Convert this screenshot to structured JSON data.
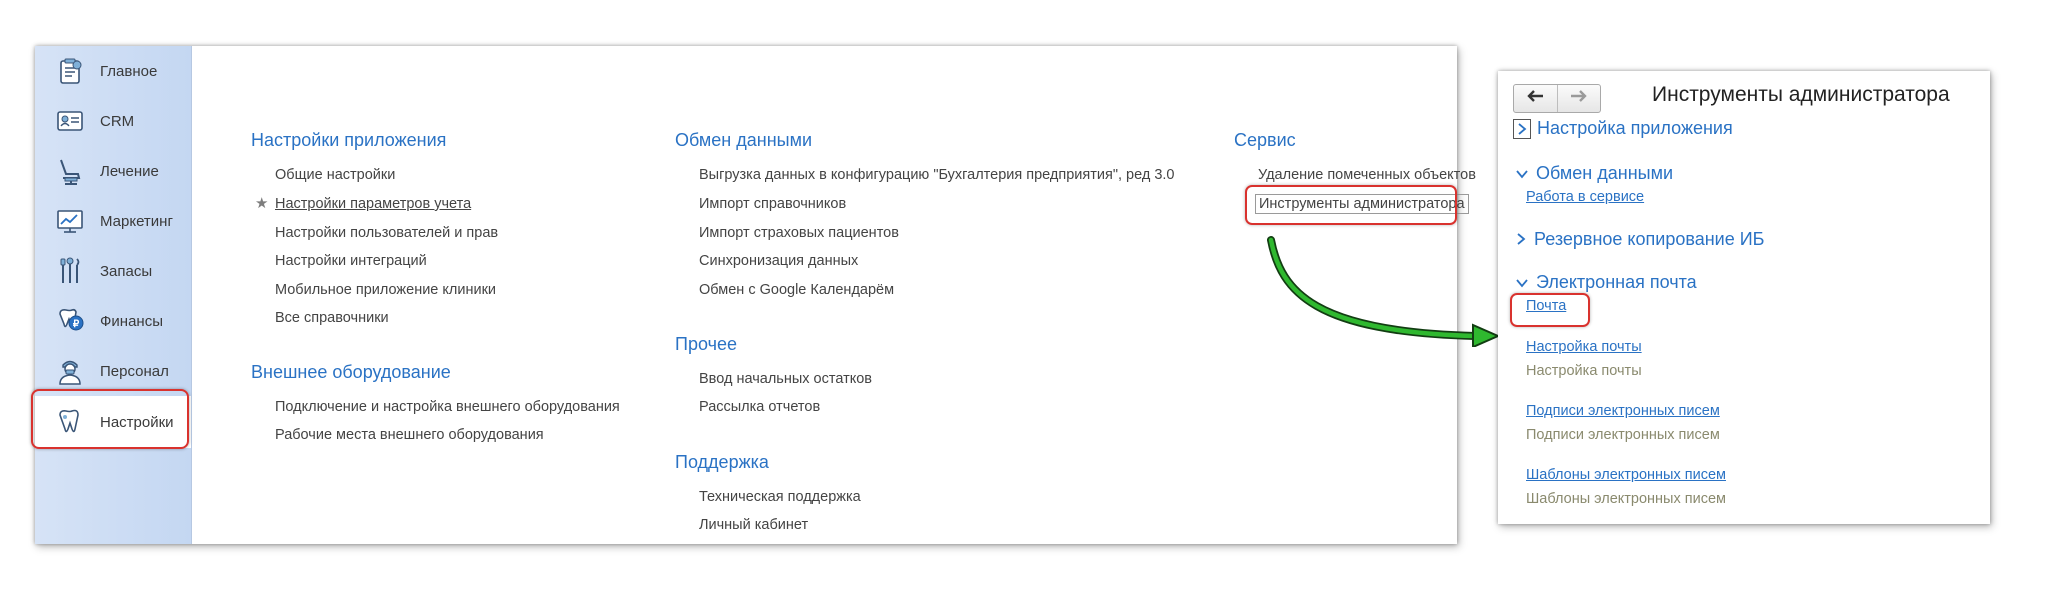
{
  "sidebar": {
    "items": [
      {
        "label": "Главное",
        "icon": "home-list-icon"
      },
      {
        "label": "CRM",
        "icon": "crm-card-icon"
      },
      {
        "label": "Лечение",
        "icon": "dental-chair-icon"
      },
      {
        "label": "Маркетинг",
        "icon": "marketing-chart-icon"
      },
      {
        "label": "Запасы",
        "icon": "dental-tools-icon"
      },
      {
        "label": "Финансы",
        "icon": "tooth-money-icon"
      },
      {
        "label": "Персонал",
        "icon": "doctor-icon"
      },
      {
        "label": "Настройки",
        "icon": "tooth-settings-icon"
      }
    ]
  },
  "main": {
    "app_settings": {
      "title": "Настройки приложения",
      "items": [
        "Общие настройки",
        "Настройки параметров учета",
        "Настройки пользователей и прав",
        "Настройки интеграций",
        "Мобильное приложение клиники",
        "Все справочники"
      ]
    },
    "external_equipment": {
      "title": "Внешнее оборудование",
      "items": [
        "Подключение и настройка внешнего оборудования",
        "Рабочие места внешнего оборудования"
      ]
    },
    "data_exchange": {
      "title": "Обмен данными",
      "items": [
        "Выгрузка данных в конфигурацию \"Бухгалтерия предприятия\", ред 3.0",
        "Импорт справочников",
        "Импорт страховых пациентов",
        "Синхронизация данных",
        "Обмен с Google Календарём"
      ]
    },
    "other": {
      "title": "Прочее",
      "items": [
        "Ввод начальных остатков",
        "Рассылка отчетов"
      ]
    },
    "support": {
      "title": "Поддержка",
      "items": [
        "Техническая поддержка",
        "Личный кабинет"
      ]
    },
    "service": {
      "title": "Сервис",
      "items": [
        "Удаление помеченных объектов",
        "Инструменты администратора"
      ]
    }
  },
  "panel": {
    "title": "Инструменты администратора",
    "nav": {
      "back_icon": "arrow-left-icon",
      "forward_icon": "arrow-right-icon"
    },
    "groups": {
      "app_settings": "Настройка приложения",
      "data_exchange": "Обмен данными",
      "data_exchange_link": "Работа в сервисе",
      "backup": "Резервное копирование ИБ",
      "email": "Электронная почта",
      "mail_link": "Почта",
      "mail_settings_link": "Настройка почты",
      "mail_settings_desc": "Настройка почты",
      "signatures_link": "Подписи электронных писем",
      "signatures_desc": "Подписи электронных писем",
      "templates_link": "Шаблоны электронных писем",
      "templates_desc": "Шаблоны электронных писем"
    }
  },
  "colors": {
    "accent": "#2a72c4",
    "highlight": "#d9322e",
    "arrow": "#22a322"
  }
}
